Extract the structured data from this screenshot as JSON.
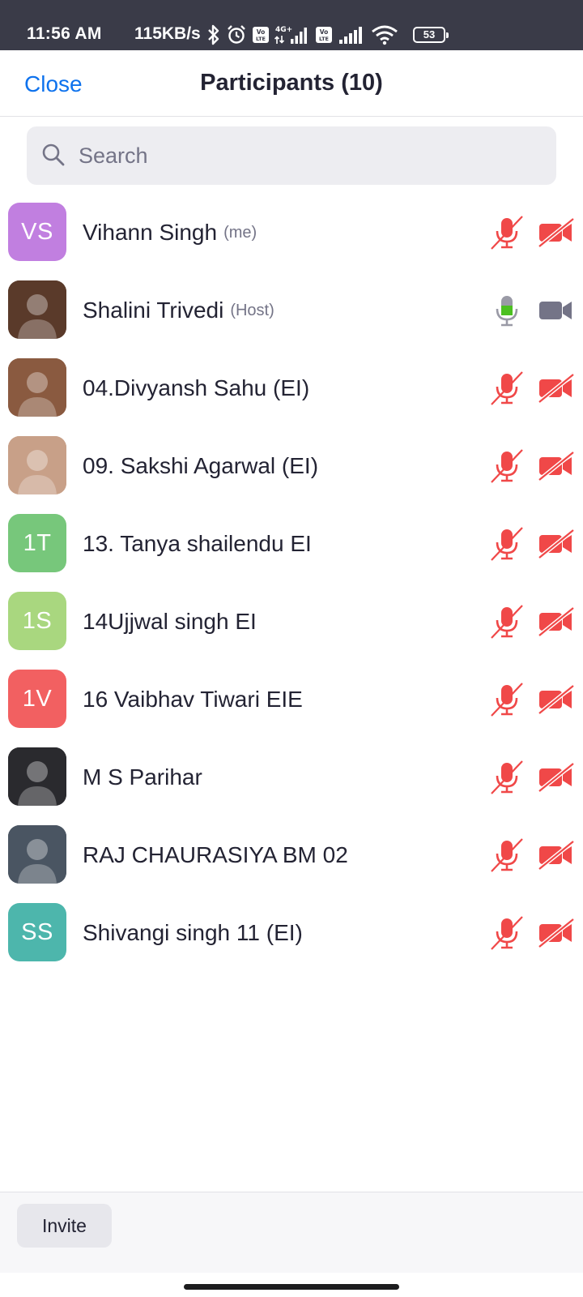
{
  "status_bar": {
    "time": "11:56 AM",
    "speed": "115KB/s",
    "battery": "53",
    "icons": [
      "bluetooth-icon",
      "alarm-icon",
      "volte-icon",
      "signal-icon",
      "volte-icon",
      "signal-icon",
      "wifi-icon",
      "battery-icon"
    ]
  },
  "header": {
    "close_label": "Close",
    "title": "Participants (10)"
  },
  "search": {
    "placeholder": "Search",
    "value": ""
  },
  "participants": [
    {
      "name": "Vihann Singh",
      "tag": "(me)",
      "avatar_initials": "VS",
      "avatar_color": "#c17fe0",
      "mic": "muted",
      "video": "off"
    },
    {
      "name": "Shalini Trivedi",
      "tag": "(Host)",
      "avatar_initials": "",
      "avatar_color": "#5a3a2a",
      "mic": "on",
      "video": "on"
    },
    {
      "name": "04.Divyansh Sahu (EI)",
      "tag": "",
      "avatar_initials": "",
      "avatar_color": "#8a5a40",
      "mic": "muted",
      "video": "off"
    },
    {
      "name": "09. Sakshi Agarwal (EI)",
      "tag": "",
      "avatar_initials": "",
      "avatar_color": "#c8a088",
      "mic": "muted",
      "video": "off"
    },
    {
      "name": "13. Tanya shailendu EI",
      "tag": "",
      "avatar_initials": "1T",
      "avatar_color": "#77c77b",
      "mic": "muted",
      "video": "off"
    },
    {
      "name": "14Ujjwal singh EI",
      "tag": "",
      "avatar_initials": "1S",
      "avatar_color": "#a9d77f",
      "mic": "muted",
      "video": "off"
    },
    {
      "name": "16 Vaibhav Tiwari EIE",
      "tag": "",
      "avatar_initials": "1V",
      "avatar_color": "#f26061",
      "mic": "muted",
      "video": "off"
    },
    {
      "name": "M S Parihar",
      "tag": "",
      "avatar_initials": "",
      "avatar_color": "#2a2a2e",
      "mic": "muted",
      "video": "off"
    },
    {
      "name": "RAJ CHAURASIYA BM 02",
      "tag": "",
      "avatar_initials": "",
      "avatar_color": "#4a5562",
      "mic": "muted",
      "video": "off"
    },
    {
      "name": "Shivangi singh 11 (EI)",
      "tag": "",
      "avatar_initials": "SS",
      "avatar_color": "#4db6ac",
      "mic": "muted",
      "video": "off"
    }
  ],
  "footer": {
    "invite_label": "Invite"
  },
  "colors": {
    "accent": "#0e72ed",
    "muted_red": "#f04848",
    "mic_on_green": "#4cc021",
    "camera_on_gray": "#747487"
  }
}
